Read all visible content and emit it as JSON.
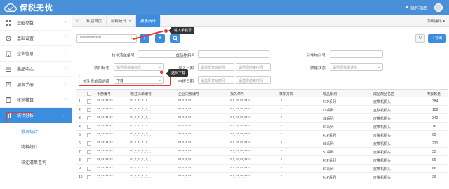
{
  "app": {
    "title": "保税无忧"
  },
  "header": {
    "guide_label": "操作指南",
    "user_name": ""
  },
  "sidebar": {
    "items": [
      {
        "label": "基础参数"
      },
      {
        "label": "基础设置"
      },
      {
        "label": "企业信息"
      },
      {
        "label": "商品中心"
      },
      {
        "label": "加贸手册"
      },
      {
        "label": "核销核算"
      },
      {
        "label": "统计分析"
      }
    ],
    "subitems": [
      {
        "label": "报表统计"
      },
      {
        "label": "物料统计"
      },
      {
        "label": "核注清单查询"
      }
    ]
  },
  "tabs": {
    "collapse": "«",
    "items": [
      {
        "label": "欢迎首页"
      },
      {
        "label": "物料统计"
      },
      {
        "label": "报表统计"
      }
    ],
    "page_ops": "页面操作"
  },
  "toolbar": {
    "phone_select_value": "**** ****** ****",
    "add_symbol": "+",
    "filter_symbol": "▼",
    "search_symbol": "🔍",
    "refresh_symbol": "↻",
    "export_label": "+ 导出",
    "tooltip_phone": "输入手机号"
  },
  "filters": {
    "row1": [
      {
        "label": "核注清单编号",
        "value": ""
      },
      {
        "label": "成品物料号",
        "value": ""
      },
      {
        "label": "料件物料号",
        "value": ""
      }
    ],
    "row2": {
      "flag_label": "核扣标志",
      "flag_placeholder": "请选择核扣标志",
      "entry_label": "录入日期",
      "start_placeholder": "请选择开始时间",
      "end_placeholder": "请选择结束时间",
      "status_label": "数据状态",
      "status_placeholder": "请选择数据状态"
    },
    "row3": {
      "source_label": "核注清单源选择",
      "source_value": "下载",
      "declare_label": "申报日期",
      "start_placeholder": "请选择开始时间",
      "end_placeholder": "请选择结束时间"
    },
    "tooltip_select": "选择下载"
  },
  "table": {
    "columns": [
      "手册编号",
      "核注清单编号",
      "企业内部编号",
      "报关单号",
      "核扣方式",
      "成品系列",
      "成品商品名名",
      "申报数量"
    ],
    "rows": [
      {
        "num": "1",
        "book": "**.**.**.**",
        "list": "**.*.**.*..*...",
        "inner": "**.*.*.**",
        "decl": "*.*.**.**.****",
        "mode": "*",
        "series": "41P系列",
        "name": "皮带机机头",
        "qty": "384"
      },
      {
        "num": "2",
        "book": "**.**.**.**",
        "list": "**.*.**.*..*...",
        "inner": "**.*.*.**",
        "decl": "*.*.**.**.****",
        "mode": "*",
        "series": "75系列",
        "name": "直联机机头",
        "qty": "108"
      },
      {
        "num": "3",
        "book": "**.**.**.**",
        "list": "**.*.**.*..*...",
        "inner": "**.*.*.**",
        "decl": "*.*.**.**.****",
        "mode": "*",
        "series": "38系列",
        "name": "皮带机机头",
        "qty": "340"
      },
      {
        "num": "4",
        "book": "**.**.**.**",
        "list": "**.*.**.*..*...",
        "inner": "**.*.*.**",
        "decl": "*.*.**.**.****",
        "mode": "*",
        "series": "37系列",
        "name": "皮带机机头",
        "qty": "76"
      },
      {
        "num": "5",
        "book": "**.**.**.**",
        "list": "**.*.**.*..*...",
        "inner": "**.*.*.**",
        "decl": "*.*.**.**.****",
        "mode": "*",
        "series": "41P系列",
        "name": "皮带机机头",
        "qty": "62"
      },
      {
        "num": "6",
        "book": "**.**.**.**",
        "list": "**.*.**.*..*...",
        "inner": "**.*.*.**",
        "decl": "*.*.**.**.****",
        "mode": "*",
        "series": "38系列",
        "name": "皮带机机头",
        "qty": "230"
      },
      {
        "num": "7",
        "book": "**.**.**.**",
        "list": "**.*.**.*..*...",
        "inner": "**.*.*.**",
        "decl": "*.*.**.**.****",
        "mode": "*",
        "series": "37系列",
        "name": "皮带机机头",
        "qty": "35"
      },
      {
        "num": "8",
        "book": "**.**.**.**",
        "list": "**.*.**.*..*...",
        "inner": "**.*.*.**",
        "decl": "*.*.**.**.****",
        "mode": "*",
        "series": "41P系列",
        "name": "皮带机机头",
        "qty": "96"
      },
      {
        "num": "9",
        "book": "**.**.**.**",
        "list": "**.*.**.*..*...",
        "inner": "**.*.*.**",
        "decl": "*.*.**.**.****",
        "mode": "*",
        "series": "37系列",
        "name": "皮带机机头",
        "qty": "66"
      },
      {
        "num": "10",
        "book": "**.**.**.**",
        "list": "**.*.**.*..*...",
        "inner": "**.*.*.**",
        "decl": "*.*.**.**.****",
        "mode": "*",
        "series": "41P系列",
        "name": "皮带机机头",
        "qty": "36"
      }
    ]
  },
  "colors": {
    "brand": "#4a90d9",
    "accent": "#3c8dde",
    "highlight": "#e53935"
  }
}
